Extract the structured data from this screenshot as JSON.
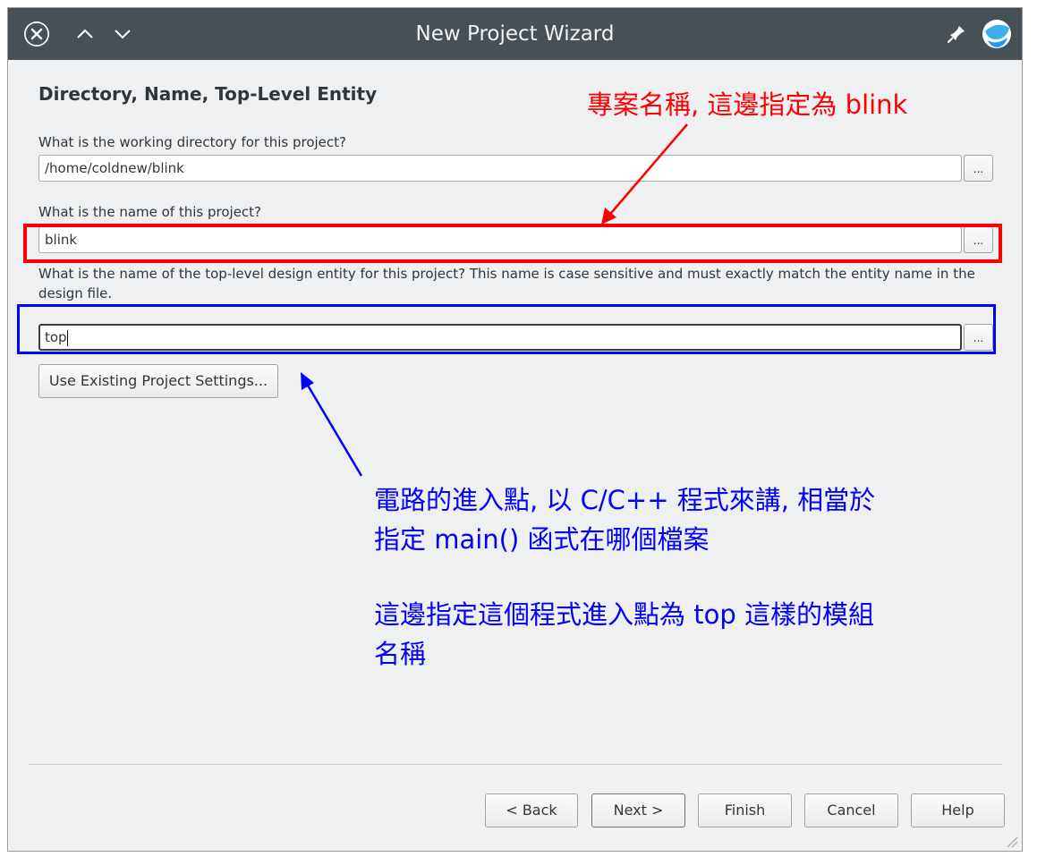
{
  "window": {
    "title": "New Project Wizard",
    "controls": [
      "close-icon",
      "chevron-up-icon",
      "chevron-down-icon"
    ],
    "title_icons": [
      "pin-icon",
      "app-logo-icon"
    ]
  },
  "page": {
    "heading": "Directory, Name, Top-Level Entity",
    "working_dir": {
      "label": "What is the working directory for this project?",
      "value": "/home/coldnew/blink",
      "browse_label": "..."
    },
    "project_name": {
      "label": "What is the name of this project?",
      "value": "blink",
      "browse_label": "..."
    },
    "top_entity": {
      "label": "What is the name of the top-level design entity for this project? This name is case sensitive and must exactly match the entity name in the design file.",
      "value": "top",
      "browse_label": "..."
    },
    "use_existing_button": "Use Existing Project Settings..."
  },
  "footer": {
    "back": "< Back",
    "next": "Next >",
    "finish": "Finish",
    "cancel": "Cancel",
    "help": "Help"
  },
  "annotations": {
    "red_note": "專案名稱, 這邊指定為 blink",
    "blue_note_line1": "電路的進入點, 以 C/C++ 程式來講, 相當於",
    "blue_note_line2": "指定 main() 函式在哪個檔案",
    "blue_note_line3": "這邊指定這個程式進入點為 top 這樣的模組",
    "blue_note_line4": "名稱",
    "colors": {
      "red": "#ff0000",
      "blue": "#0000ff"
    }
  },
  "colors": {
    "titlebar": "#475057",
    "dialog_bg": "#eff0f1",
    "accent": "#3daee9"
  }
}
